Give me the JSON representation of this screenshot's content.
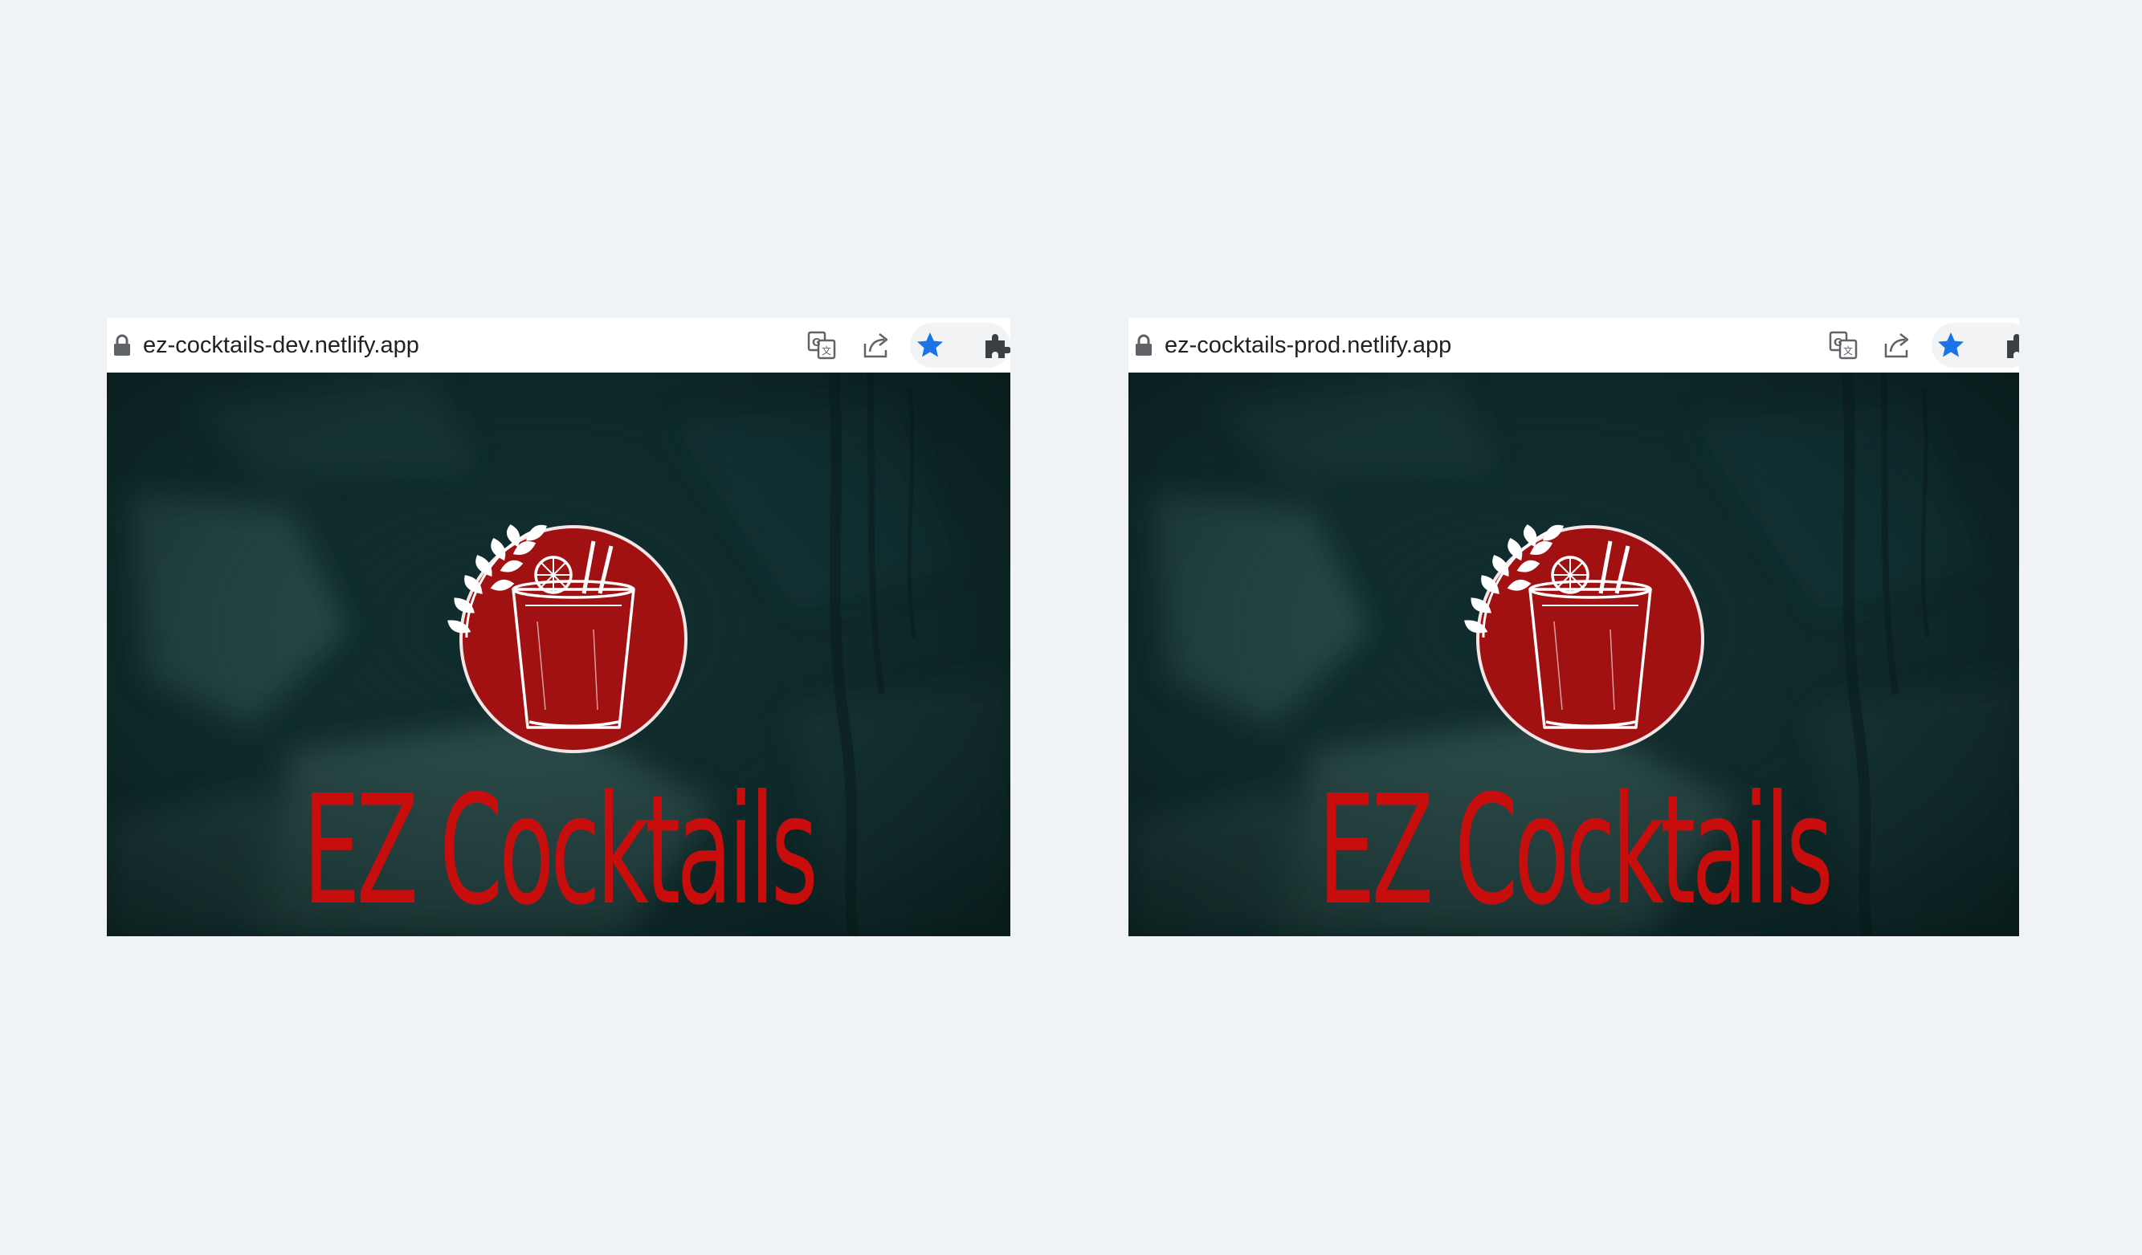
{
  "colors": {
    "page_background": "#eff3f5",
    "brand_red": "#c80d0d",
    "logo_red": "#a11111",
    "hero_background": "#0d2727",
    "bookmark_star": "#1a73e8",
    "toolbar_icon": "#5f6368"
  },
  "windows": [
    {
      "url": "ez-cocktails-dev.netlify.app",
      "site_title": "EZ Cocktails",
      "icons": [
        "lock-icon",
        "translate-icon",
        "share-icon",
        "star-icon",
        "extensions-icon"
      ],
      "bookmarked": true
    },
    {
      "url": "ez-cocktails-prod.netlify.app",
      "site_title": "EZ Cocktails",
      "icons": [
        "lock-icon",
        "translate-icon",
        "share-icon",
        "star-icon",
        "extensions-icon"
      ],
      "bookmarked": true
    }
  ]
}
